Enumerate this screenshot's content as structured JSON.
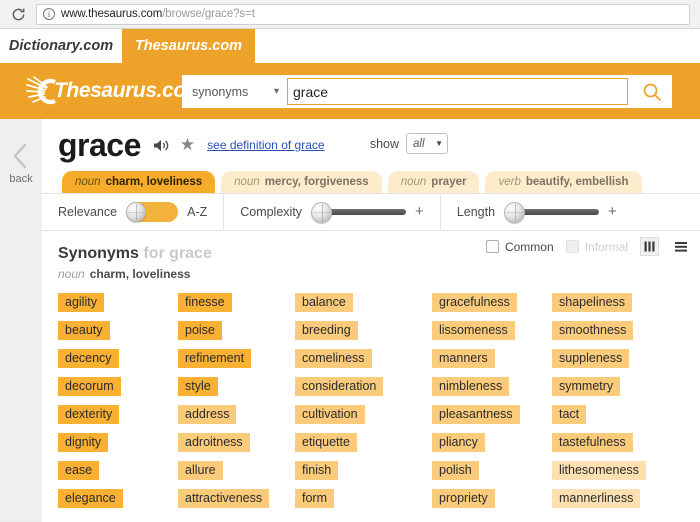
{
  "browser": {
    "reload_icon": "reload-icon",
    "info_icon": "page-info-icon",
    "url_host": "www.thesaurus.com",
    "url_path": "/browse/grace?s=t"
  },
  "site_tabs": [
    {
      "label": "Dictionary.com",
      "active": false
    },
    {
      "label": "Thesaurus.com",
      "active": true
    }
  ],
  "header": {
    "logo_text": "Thesaurus.com",
    "logo_icon": "sunburst-icon",
    "search_type": "synonyms",
    "search_chevron_icon": "chevron-down-icon",
    "search_value": "grace",
    "search_placeholder": "",
    "search_icon": "search-icon"
  },
  "back": {
    "icon": "chevron-left-icon",
    "label": "back"
  },
  "word": {
    "title": "grace",
    "speaker_icon": "speaker-icon",
    "star_icon": "star-icon",
    "definition_link": "see definition of grace",
    "show_label": "show",
    "show_value": "all",
    "show_caret_icon": "caret-down-icon"
  },
  "sense_tabs": [
    {
      "pos": "noun",
      "gloss": "charm, loveliness",
      "active": true
    },
    {
      "pos": "noun",
      "gloss": "mercy, forgiveness",
      "active": false
    },
    {
      "pos": "noun",
      "gloss": "prayer",
      "active": false
    },
    {
      "pos": "verb",
      "gloss": "beautify, embellish",
      "active": false
    }
  ],
  "filters": [
    {
      "label": "Relevance",
      "control": "toggle",
      "end_label": "A-Z"
    },
    {
      "label": "Complexity",
      "control": "slider",
      "plus": "+"
    },
    {
      "label": "Length",
      "control": "slider",
      "plus": "+"
    }
  ],
  "synonyms_section": {
    "title_main": "Synonyms",
    "title_for": "for grace",
    "common_label": "Common",
    "informal_label": "Informal",
    "grid_view_icon": "grid-view-icon",
    "list_view_icon": "list-view-icon",
    "sub_pos": "noun",
    "sub_gloss": "charm, loveliness"
  },
  "colors": {
    "brand_orange": "#eda229",
    "relevance_high": "#f8b133",
    "relevance_mid": "#fbcb7c",
    "relevance_low": "#fde0b2",
    "link_blue": "#2a4fb5"
  },
  "synonym_columns": [
    {
      "items": [
        {
          "text": "agility",
          "level": 3
        },
        {
          "text": "beauty",
          "level": 3
        },
        {
          "text": "decency",
          "level": 3
        },
        {
          "text": "decorum",
          "level": 3
        },
        {
          "text": "dexterity",
          "level": 3
        },
        {
          "text": "dignity",
          "level": 3
        },
        {
          "text": "ease",
          "level": 3
        },
        {
          "text": "elegance",
          "level": 3
        }
      ]
    },
    {
      "items": [
        {
          "text": "finesse",
          "level": 3
        },
        {
          "text": "poise",
          "level": 3
        },
        {
          "text": "refinement",
          "level": 3
        },
        {
          "text": "style",
          "level": 3
        },
        {
          "text": "address",
          "level": 2
        },
        {
          "text": "adroitness",
          "level": 2
        },
        {
          "text": "allure",
          "level": 2
        },
        {
          "text": "attractiveness",
          "level": 2
        }
      ]
    },
    {
      "items": [
        {
          "text": "balance",
          "level": 2
        },
        {
          "text": "breeding",
          "level": 2
        },
        {
          "text": "comeliness",
          "level": 2
        },
        {
          "text": "consideration",
          "level": 2
        },
        {
          "text": "cultivation",
          "level": 2
        },
        {
          "text": "etiquette",
          "level": 2
        },
        {
          "text": "finish",
          "level": 2
        },
        {
          "text": "form",
          "level": 2
        }
      ]
    },
    {
      "items": [
        {
          "text": "gracefulness",
          "level": 2
        },
        {
          "text": "lissomeness",
          "level": 2
        },
        {
          "text": "manners",
          "level": 2
        },
        {
          "text": "nimbleness",
          "level": 2
        },
        {
          "text": "pleasantness",
          "level": 2
        },
        {
          "text": "pliancy",
          "level": 2
        },
        {
          "text": "polish",
          "level": 2
        },
        {
          "text": "propriety",
          "level": 2
        }
      ]
    },
    {
      "items": [
        {
          "text": "shapeliness",
          "level": 2
        },
        {
          "text": "smoothness",
          "level": 2
        },
        {
          "text": "suppleness",
          "level": 2
        },
        {
          "text": "symmetry",
          "level": 2
        },
        {
          "text": "tact",
          "level": 2
        },
        {
          "text": "tastefulness",
          "level": 2
        },
        {
          "text": "lithesomeness",
          "level": 1
        },
        {
          "text": "mannerliness",
          "level": 1
        }
      ]
    }
  ]
}
